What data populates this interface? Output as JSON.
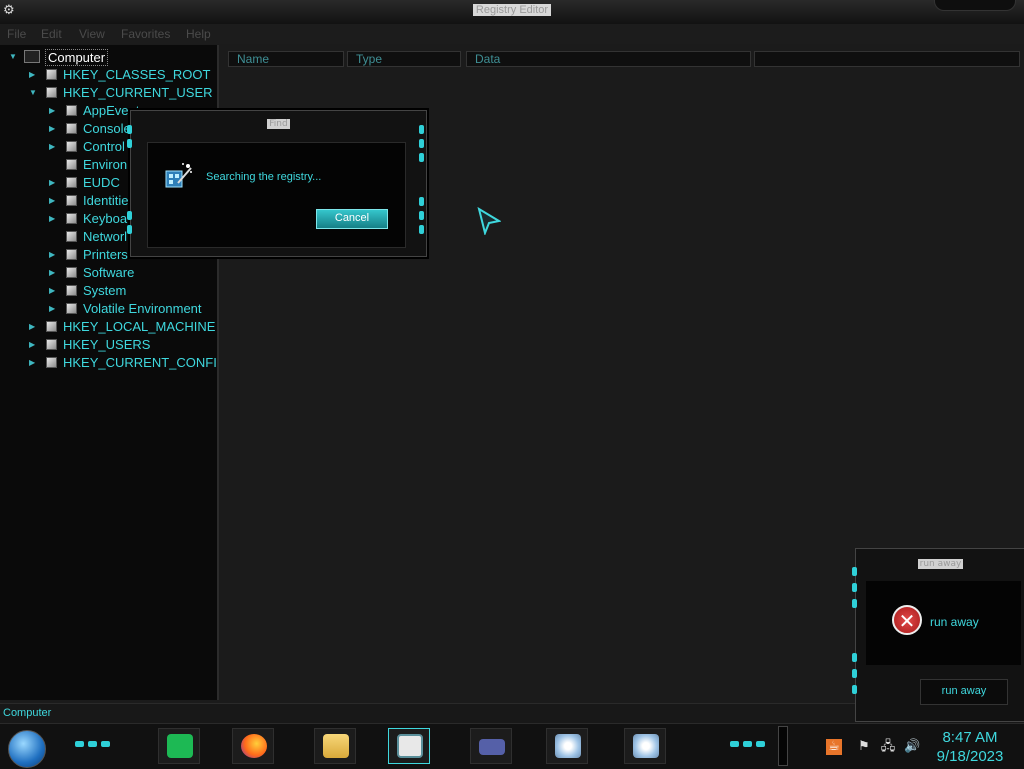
{
  "window": {
    "title": "Registry Editor"
  },
  "menu": [
    "File",
    "Edit",
    "View",
    "Favorites",
    "Help"
  ],
  "tree": {
    "root": "Computer",
    "nodes": [
      {
        "label": "HKEY_CLASSES_ROOT",
        "level": 1,
        "expanded": false
      },
      {
        "label": "HKEY_CURRENT_USER",
        "level": 1,
        "expanded": true
      },
      {
        "label": "AppEvents",
        "level": 2,
        "expanded": false
      },
      {
        "label": "Console",
        "level": 2,
        "expanded": false
      },
      {
        "label": "Control",
        "level": 2,
        "expanded": false
      },
      {
        "label": "Environ",
        "level": 2,
        "expanded": null
      },
      {
        "label": "EUDC",
        "level": 2,
        "expanded": false
      },
      {
        "label": "Identitie",
        "level": 2,
        "expanded": false
      },
      {
        "label": "Keyboa",
        "level": 2,
        "expanded": false
      },
      {
        "label": "Networl",
        "level": 2,
        "expanded": null
      },
      {
        "label": "Printers",
        "level": 2,
        "expanded": false
      },
      {
        "label": "Software",
        "level": 2,
        "expanded": false
      },
      {
        "label": "System",
        "level": 2,
        "expanded": false
      },
      {
        "label": "Volatile Environment",
        "level": 2,
        "expanded": false
      },
      {
        "label": "HKEY_LOCAL_MACHINE",
        "level": 1,
        "expanded": false
      },
      {
        "label": "HKEY_USERS",
        "level": 1,
        "expanded": false
      },
      {
        "label": "HKEY_CURRENT_CONFI",
        "level": 1,
        "expanded": false
      }
    ]
  },
  "columns": [
    "Name",
    "Type",
    "Data"
  ],
  "status": "Computer",
  "find_dialog": {
    "title": "Find",
    "message": "Searching the registry...",
    "cancel": "Cancel"
  },
  "error_dialog": {
    "title": "run away",
    "message": "run away",
    "button": "run away"
  },
  "clock": {
    "time": "8:47 AM",
    "date": "9/18/2023"
  },
  "colors": {
    "accent": "#3fd8de",
    "background": "#1b1b1b"
  },
  "taskbar_apps": [
    "spotify-icon",
    "firefox-icon",
    "file-explorer-icon",
    "notepad-icon",
    "card-icon",
    "disc-utility-icon",
    "disc-utility-icon-2"
  ],
  "tray_icons": [
    "java-icon",
    "flag-icon",
    "network-icon",
    "volume-icon"
  ]
}
